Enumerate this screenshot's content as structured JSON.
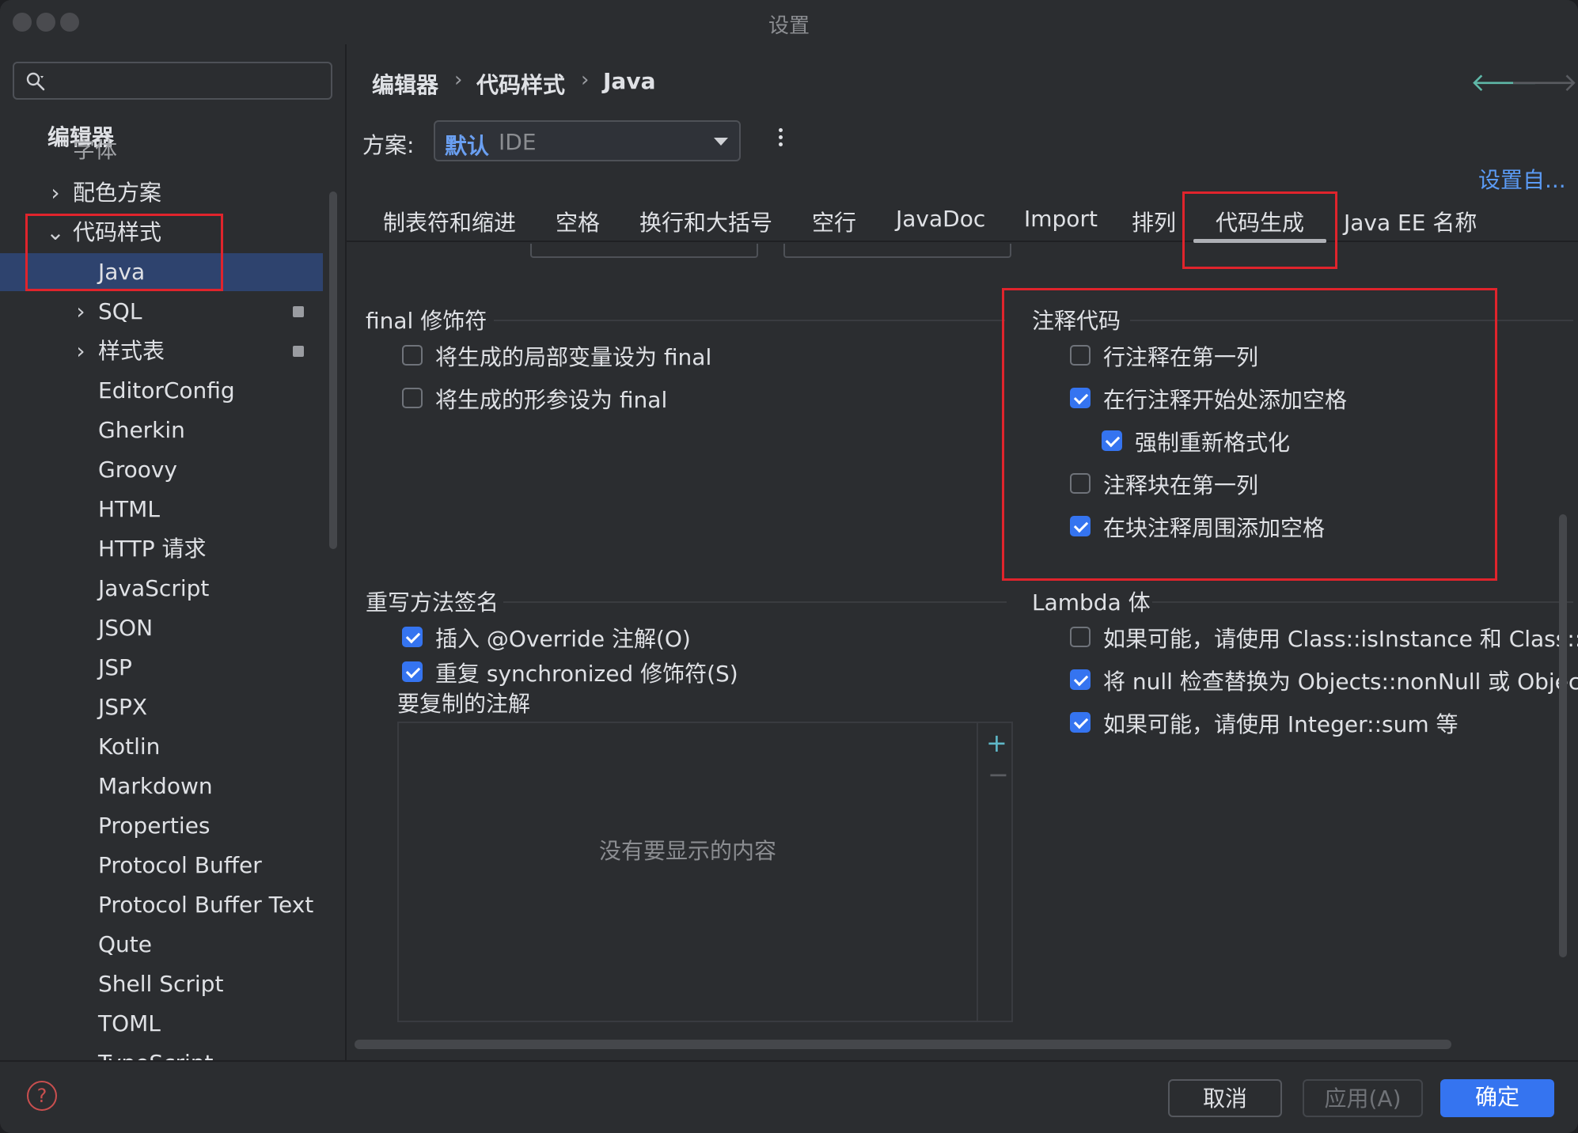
{
  "window": {
    "title": "设置"
  },
  "sidebar": {
    "search_placeholder": "",
    "root": "编辑器",
    "root_sub": "字体",
    "items": [
      {
        "label": "配色方案",
        "chevron": "›"
      },
      {
        "label": "代码样式",
        "chevron": "⌄"
      },
      {
        "label": "Java"
      },
      {
        "label": "SQL",
        "chevron": "›"
      },
      {
        "label": "样式表",
        "chevron": "›"
      },
      {
        "label": "EditorConfig"
      },
      {
        "label": "Gherkin"
      },
      {
        "label": "Groovy"
      },
      {
        "label": "HTML"
      },
      {
        "label": "HTTP 请求"
      },
      {
        "label": "JavaScript"
      },
      {
        "label": "JSON"
      },
      {
        "label": "JSP"
      },
      {
        "label": "JSPX"
      },
      {
        "label": "Kotlin"
      },
      {
        "label": "Markdown"
      },
      {
        "label": "Properties"
      },
      {
        "label": "Protocol Buffer"
      },
      {
        "label": "Protocol Buffer Text"
      },
      {
        "label": "Qute"
      },
      {
        "label": "Shell Script"
      },
      {
        "label": "TOML"
      },
      {
        "label": "TypeScript"
      }
    ]
  },
  "breadcrumb": {
    "sep": "›",
    "items": [
      "编辑器",
      "代码样式",
      "Java"
    ]
  },
  "nav": {
    "back": "🡐",
    "forward": "🡒"
  },
  "scheme": {
    "label": "方案:",
    "value_primary": "默认",
    "value_secondary": "IDE"
  },
  "settings_link": "设置自...",
  "tabs": [
    "制表符和缩进",
    "空格",
    "换行和大括号",
    "空行",
    "JavaDoc",
    "Import",
    "排列",
    "代码生成",
    "Java EE 名称"
  ],
  "sections": {
    "final_modifier": {
      "title": "final 修饰符",
      "options": [
        {
          "label": "将生成的局部变量设为 final",
          "checked": false
        },
        {
          "label": "将生成的形参设为 final",
          "checked": false
        }
      ]
    },
    "comment_code": {
      "title": "注释代码",
      "options": [
        {
          "label": "行注释在第一列",
          "checked": false
        },
        {
          "label": "在行注释开始处添加空格",
          "checked": true
        },
        {
          "label": "强制重新格式化",
          "checked": true
        },
        {
          "label": "注释块在第一列",
          "checked": false
        },
        {
          "label": "在块注释周围添加空格",
          "checked": true
        }
      ]
    },
    "override_signature": {
      "title": "重写方法签名",
      "options": [
        {
          "label": "插入 @Override 注解(O)",
          "checked": true
        },
        {
          "label": "重复 synchronized 修饰符(S)",
          "checked": true
        }
      ],
      "annotations_label": "要复制的注解",
      "empty_text": "没有要显示的内容",
      "add": "+",
      "remove": "−"
    },
    "lambda_body": {
      "title": "Lambda 体",
      "options": [
        {
          "label": "如果可能，请使用 Class::isInstance 和 Class::cast",
          "checked": false
        },
        {
          "label": "将 null 检查替换为 Objects::nonNull 或 Objects::isNull",
          "checked": true
        },
        {
          "label": "如果可能，请使用 Integer::sum 等",
          "checked": true
        }
      ]
    }
  },
  "footer": {
    "help": "?",
    "cancel": "取消",
    "apply": "应用(A)",
    "ok": "确定"
  },
  "colors": {
    "accent": "#3574f0",
    "selection": "#2e436e",
    "highlight_box": "#e0242c",
    "link": "#5b9bf5"
  }
}
